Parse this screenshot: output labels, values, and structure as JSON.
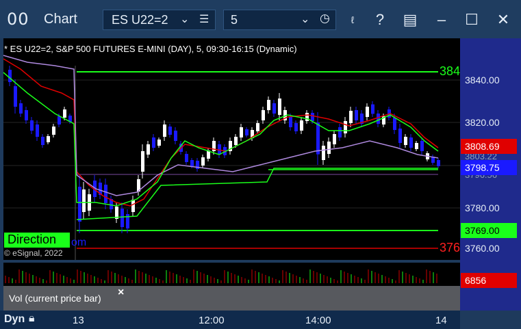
{
  "titlebar": {
    "app_icon": "00",
    "app_title": "Chart",
    "symbol": "ES U22=2",
    "interval": "5",
    "icons": [
      "dropdown-caret-icon",
      "list-icon",
      "clock-icon",
      "link-icon",
      "help-icon",
      "save-layout-icon",
      "minimize-icon",
      "maximize-icon",
      "close-icon"
    ]
  },
  "chart": {
    "header": "* ES U22=2, S&P 500 FUTURES E-MINI (DAY), 5, 09:30-16:15 (Dynamic)",
    "copyright": "© eSignal, 2022",
    "direction": "Direction",
    "direction_suffix": "om",
    "level_left_top": "384",
    "level_left_bottom": "376"
  },
  "price_axis": {
    "labels": [
      "3840.00",
      "3820.00",
      "3780.00",
      "3760.00"
    ],
    "hidden_labels": [
      "3803.22",
      "3796.56"
    ],
    "boxes": [
      {
        "value": "3808.69",
        "bg": "#e00000",
        "fg": "#ffffff"
      },
      {
        "value": "3798.75",
        "bg": "#1a1aff",
        "fg": "#ffffff"
      },
      {
        "value": "3769.00",
        "bg": "#1aff1a",
        "fg": "#000000"
      },
      {
        "value": "6856",
        "bg": "#e00000",
        "fg": "#ffffff"
      }
    ]
  },
  "volume": {
    "label": "Vol (current price bar)",
    "close": "×"
  },
  "time_axis": {
    "dyn": "Dyn",
    "labels": [
      "13",
      "12:00",
      "14:00",
      "14"
    ]
  },
  "colors": {
    "up_candle": "#ffffff",
    "down_candle": "#1a1aff",
    "ema_red": "#e00000",
    "ema_green": "#1aff1a",
    "vwap": "#b08ae0",
    "volume": "#d00000"
  }
}
